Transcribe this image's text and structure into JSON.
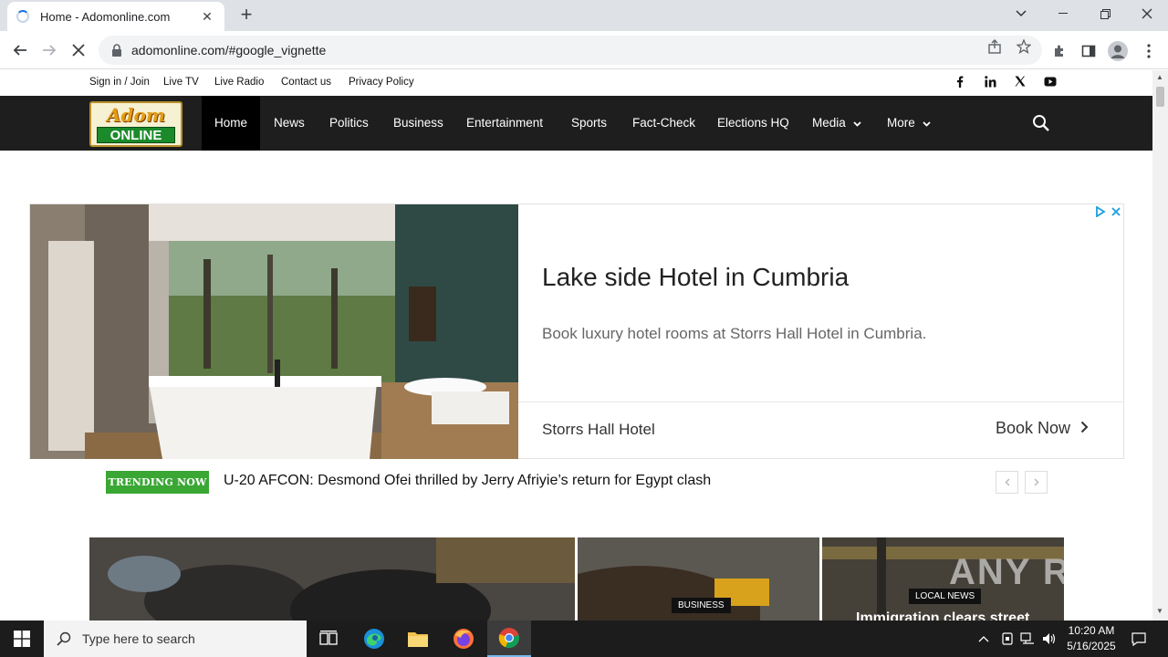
{
  "browser": {
    "tab_title": "Home - Adomonline.com",
    "url": "adomonline.com/#google_vignette"
  },
  "site": {
    "logo": {
      "line1": "Adom",
      "line2": "ONLINE"
    },
    "top_links": [
      "Sign in / Join",
      "Live TV",
      "Live Radio",
      "Contact us",
      "Privacy Policy"
    ],
    "social_icons": [
      "facebook-icon",
      "linkedin-icon",
      "x-icon",
      "youtube-icon"
    ],
    "nav": [
      {
        "label": "Home",
        "active": true
      },
      {
        "label": "News"
      },
      {
        "label": "Politics"
      },
      {
        "label": "Business"
      },
      {
        "label": "Entertainment"
      },
      {
        "label": "Sports"
      },
      {
        "label": "Fact-Check"
      },
      {
        "label": "Elections HQ"
      },
      {
        "label": "Media",
        "dropdown": true
      },
      {
        "label": "More",
        "dropdown": true
      }
    ]
  },
  "ad": {
    "headline": "Lake side Hotel in Cumbria",
    "description": "Book luxury hotel rooms at Storrs Hall Hotel in Cumbria.",
    "advertiser": "Storrs Hall Hotel",
    "cta": "Book Now"
  },
  "trending": {
    "badge": "TRENDING NOW",
    "headline": "U-20 AFCON: Desmond Ofei thrilled by Jerry Afriyie’s return for Egypt clash"
  },
  "tiles": [
    {
      "label": ""
    },
    {
      "label": "BUSINESS"
    },
    {
      "label": "LOCAL NEWS",
      "headline": "Immigration clears street"
    }
  ],
  "watermark": "ANY RUN",
  "taskbar": {
    "search_placeholder": "Type here to search",
    "time": "10:20 AM",
    "date": "5/16/2025"
  },
  "colors": {
    "nav_bg": "#1e1e1e",
    "trending_green": "#3aa735",
    "taskbar_bg": "#1c1c1c"
  }
}
